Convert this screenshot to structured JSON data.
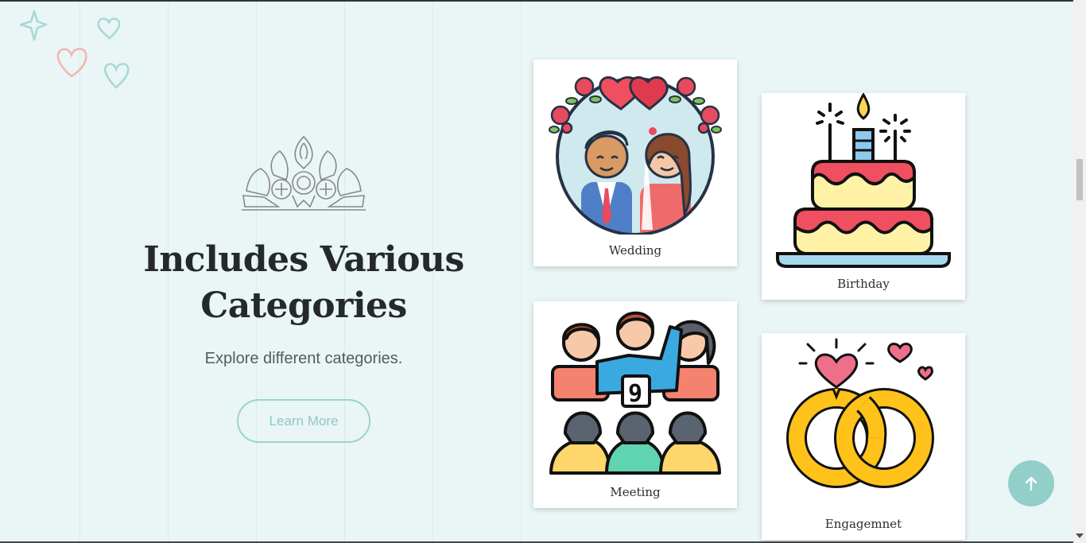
{
  "hero": {
    "title_line1": "Includes Various",
    "title_line2": "Categories",
    "subtitle": "Explore different categories.",
    "button_label": "Learn More"
  },
  "categories": [
    {
      "label": "Wedding",
      "icon": "wedding-couple-icon"
    },
    {
      "label": "Birthday",
      "icon": "birthday-cake-icon"
    },
    {
      "label": "Meeting",
      "icon": "meeting-people-icon"
    },
    {
      "label": "Engagemnet",
      "icon": "engagement-rings-icon"
    }
  ],
  "scroll_to_top": {
    "icon": "arrow-up-icon"
  },
  "colors": {
    "background": "#eaf5f6",
    "accent": "#93cfc9",
    "heading": "#25292d"
  }
}
